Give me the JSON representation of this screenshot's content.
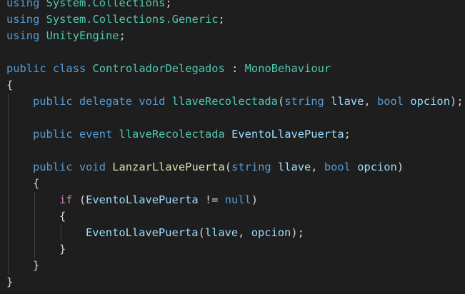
{
  "editor": {
    "theme": "dark",
    "colors": {
      "background": "#1e1e1e",
      "keyword": "#569cd6",
      "control": "#c586c0",
      "type": "#4ec9b0",
      "function": "#dcdcaa",
      "parameter": "#9cdcfe",
      "plain": "#d4d4d4",
      "indent_guide": "#404040"
    },
    "lines": [
      {
        "indent": 0,
        "tokens": [
          {
            "text": "using",
            "kind": "keyword"
          },
          {
            "text": " ",
            "kind": "plain"
          },
          {
            "text": "System.Collections",
            "kind": "type"
          },
          {
            "text": ";",
            "kind": "plain"
          }
        ]
      },
      {
        "indent": 0,
        "tokens": [
          {
            "text": "using",
            "kind": "keyword"
          },
          {
            "text": " ",
            "kind": "plain"
          },
          {
            "text": "System.Collections.Generic",
            "kind": "type"
          },
          {
            "text": ";",
            "kind": "plain"
          }
        ]
      },
      {
        "indent": 0,
        "tokens": [
          {
            "text": "using",
            "kind": "keyword"
          },
          {
            "text": " ",
            "kind": "plain"
          },
          {
            "text": "UnityEngine",
            "kind": "type"
          },
          {
            "text": ";",
            "kind": "plain"
          }
        ]
      },
      {
        "indent": 0,
        "tokens": []
      },
      {
        "indent": 0,
        "tokens": [
          {
            "text": "public",
            "kind": "keyword"
          },
          {
            "text": " ",
            "kind": "plain"
          },
          {
            "text": "class",
            "kind": "keyword"
          },
          {
            "text": " ",
            "kind": "plain"
          },
          {
            "text": "ControladorDelegados",
            "kind": "type"
          },
          {
            "text": " : ",
            "kind": "plain"
          },
          {
            "text": "MonoBehaviour",
            "kind": "type"
          }
        ]
      },
      {
        "indent": 0,
        "tokens": [
          {
            "text": "{",
            "kind": "plain"
          }
        ]
      },
      {
        "indent": 1,
        "tokens": [
          {
            "text": "public",
            "kind": "keyword"
          },
          {
            "text": " ",
            "kind": "plain"
          },
          {
            "text": "delegate",
            "kind": "keyword"
          },
          {
            "text": " ",
            "kind": "plain"
          },
          {
            "text": "void",
            "kind": "keyword"
          },
          {
            "text": " ",
            "kind": "plain"
          },
          {
            "text": "llaveRecolectada",
            "kind": "type"
          },
          {
            "text": "(",
            "kind": "plain"
          },
          {
            "text": "string",
            "kind": "keyword"
          },
          {
            "text": " ",
            "kind": "plain"
          },
          {
            "text": "llave",
            "kind": "parameter"
          },
          {
            "text": ", ",
            "kind": "plain"
          },
          {
            "text": "bool",
            "kind": "keyword"
          },
          {
            "text": " ",
            "kind": "plain"
          },
          {
            "text": "opcion",
            "kind": "parameter"
          },
          {
            "text": ");",
            "kind": "plain"
          }
        ]
      },
      {
        "indent": 1,
        "tokens": []
      },
      {
        "indent": 1,
        "tokens": [
          {
            "text": "public",
            "kind": "keyword"
          },
          {
            "text": " ",
            "kind": "plain"
          },
          {
            "text": "event",
            "kind": "keyword"
          },
          {
            "text": " ",
            "kind": "plain"
          },
          {
            "text": "llaveRecolectada",
            "kind": "type"
          },
          {
            "text": " ",
            "kind": "plain"
          },
          {
            "text": "EventoLlavePuerta",
            "kind": "parameter"
          },
          {
            "text": ";",
            "kind": "plain"
          }
        ]
      },
      {
        "indent": 1,
        "tokens": []
      },
      {
        "indent": 1,
        "tokens": [
          {
            "text": "public",
            "kind": "keyword"
          },
          {
            "text": " ",
            "kind": "plain"
          },
          {
            "text": "void",
            "kind": "keyword"
          },
          {
            "text": " ",
            "kind": "plain"
          },
          {
            "text": "LanzarLlavePuerta",
            "kind": "function"
          },
          {
            "text": "(",
            "kind": "plain"
          },
          {
            "text": "string",
            "kind": "keyword"
          },
          {
            "text": " ",
            "kind": "plain"
          },
          {
            "text": "llave",
            "kind": "parameter"
          },
          {
            "text": ", ",
            "kind": "plain"
          },
          {
            "text": "bool",
            "kind": "keyword"
          },
          {
            "text": " ",
            "kind": "plain"
          },
          {
            "text": "opcion",
            "kind": "parameter"
          },
          {
            "text": ")",
            "kind": "plain"
          }
        ]
      },
      {
        "indent": 1,
        "tokens": [
          {
            "text": "{",
            "kind": "plain"
          }
        ]
      },
      {
        "indent": 2,
        "tokens": [
          {
            "text": "if",
            "kind": "control"
          },
          {
            "text": " (",
            "kind": "plain"
          },
          {
            "text": "EventoLlavePuerta",
            "kind": "parameter"
          },
          {
            "text": " != ",
            "kind": "plain"
          },
          {
            "text": "null",
            "kind": "keyword"
          },
          {
            "text": ")",
            "kind": "plain"
          }
        ]
      },
      {
        "indent": 2,
        "tokens": [
          {
            "text": "{",
            "kind": "plain"
          }
        ]
      },
      {
        "indent": 3,
        "tokens": [
          {
            "text": "EventoLlavePuerta",
            "kind": "parameter"
          },
          {
            "text": "(",
            "kind": "plain"
          },
          {
            "text": "llave",
            "kind": "parameter"
          },
          {
            "text": ", ",
            "kind": "plain"
          },
          {
            "text": "opcion",
            "kind": "parameter"
          },
          {
            "text": ");",
            "kind": "plain"
          }
        ]
      },
      {
        "indent": 2,
        "tokens": [
          {
            "text": "}",
            "kind": "plain"
          }
        ]
      },
      {
        "indent": 1,
        "tokens": [
          {
            "text": "}",
            "kind": "plain"
          }
        ]
      },
      {
        "indent": 0,
        "tokens": [
          {
            "text": "}",
            "kind": "plain"
          }
        ]
      }
    ]
  }
}
